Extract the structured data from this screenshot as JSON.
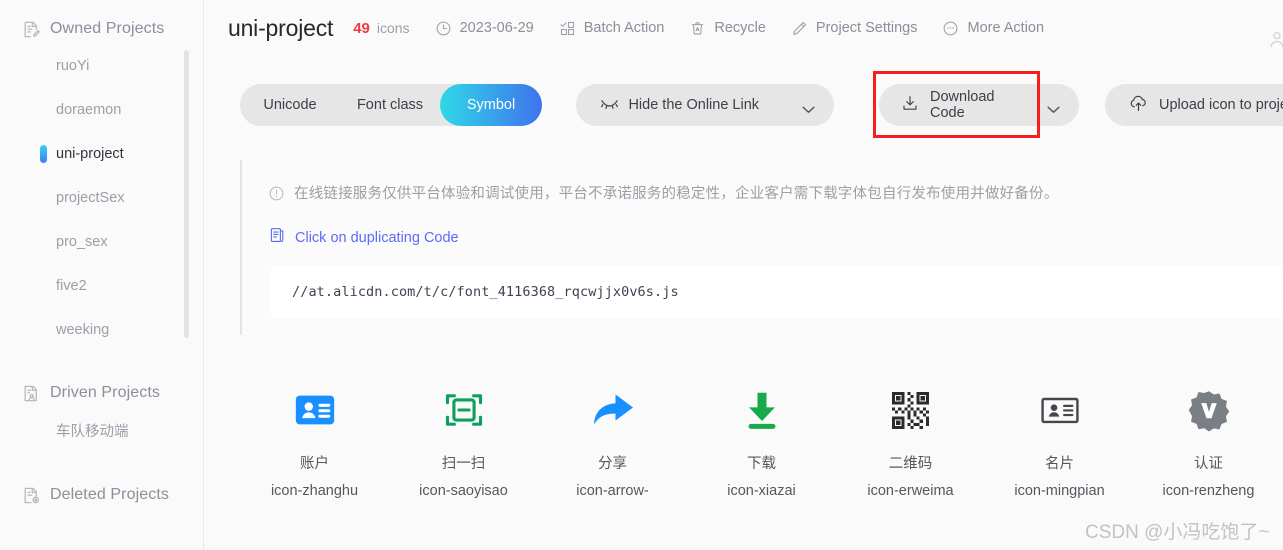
{
  "sidebar": {
    "groups": [
      {
        "label": "Owned Projects",
        "icon": "document-pencil-icon",
        "items": [
          {
            "label": "ruoYi",
            "active": false
          },
          {
            "label": "doraemon",
            "active": false
          },
          {
            "label": "uni-project",
            "active": true
          },
          {
            "label": "projectSex",
            "active": false
          },
          {
            "label": "pro_sex",
            "active": false
          },
          {
            "label": "five2",
            "active": false
          },
          {
            "label": "weeking",
            "active": false
          }
        ]
      },
      {
        "label": "Driven Projects",
        "icon": "document-person-icon",
        "items": [
          {
            "label": "车队移动端",
            "active": false
          }
        ]
      },
      {
        "label": "Deleted Projects",
        "icon": "document-delete-icon",
        "items": []
      }
    ]
  },
  "header": {
    "project_title": "uni-project",
    "icon_count": "49",
    "icon_count_label": "icons",
    "date": "2023-06-29",
    "date_icon": "clock-icon",
    "actions": [
      {
        "label": "Batch Action",
        "icon": "batch-action-icon"
      },
      {
        "label": "Recycle",
        "icon": "trash-icon"
      },
      {
        "label": "Project Settings",
        "icon": "pencil-icon"
      },
      {
        "label": "More Action",
        "icon": "ellipsis-circle-icon"
      }
    ]
  },
  "toolbar": {
    "segments": [
      {
        "label": "Unicode",
        "active": false
      },
      {
        "label": "Font class",
        "active": false
      },
      {
        "label": "Symbol",
        "active": true
      }
    ],
    "hide_link": {
      "label": "Hide the Online Link",
      "icon": "eye-closed-icon"
    },
    "download": {
      "label": "Download Code",
      "icon": "download-icon"
    },
    "upload": {
      "label": "Upload icon to project",
      "icon": "cloud-upload-icon"
    },
    "accent_gradient_from": "#2fd8e8",
    "accent_gradient_to": "#3f73ec",
    "highlight_box_color": "#f41f1f"
  },
  "notice": {
    "icon": "exclamation-circle-icon",
    "text": "在线链接服务仅供平台体验和调试使用，平台不承诺服务的稳定性，企业客户需下载字体包自行发布使用并做好备份。",
    "duplicate_link": {
      "label": "Click on duplicating Code",
      "icon": "copy-icon",
      "color": "#5b6bf5"
    },
    "code": "//at.alicdn.com/t/c/font_4116368_rqcwjjx0v6s.js"
  },
  "icons": [
    {
      "cn": "账户",
      "en": "icon-zhanghu",
      "glyph": "account-card-icon",
      "color": "#1890ff"
    },
    {
      "cn": "扫一扫",
      "en": "icon-saoyisao",
      "glyph": "scan-icon",
      "color": "#0ba15c"
    },
    {
      "cn": "分享",
      "en": "icon-arrow-",
      "glyph": "share-arrow-icon",
      "color": "#1890ff"
    },
    {
      "cn": "下载",
      "en": "icon-xiazai",
      "glyph": "download-arrow-icon",
      "color": "#17a94a"
    },
    {
      "cn": "二维码",
      "en": "icon-erweima",
      "glyph": "qr-code-icon",
      "color": "#2b2b2b"
    },
    {
      "cn": "名片",
      "en": "icon-mingpian",
      "glyph": "business-card-icon",
      "color": "#43474c"
    },
    {
      "cn": "认证",
      "en": "icon-renzheng",
      "glyph": "verified-badge-icon",
      "color": "#7a7f86"
    }
  ],
  "watermark": "CSDN @小冯吃饱了~"
}
